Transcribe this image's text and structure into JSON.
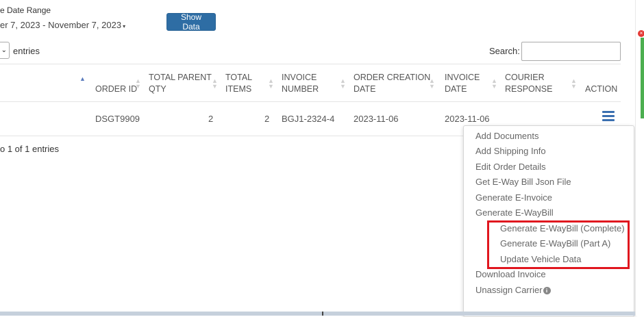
{
  "filters": {
    "date_range_label": "e Date Range",
    "date_range_value": "er 7, 2023 - November 7, 2023",
    "date_caret": "▾",
    "show_button": "Show Data"
  },
  "table_controls": {
    "length_caret": "⌄",
    "entries_label": "entries",
    "search_label": "Search:",
    "search_value": ""
  },
  "table": {
    "columns": [
      {
        "line1": "ORDER ID",
        "line2": ""
      },
      {
        "line1": "TOTAL PARENT",
        "line2": "QTY"
      },
      {
        "line1": "TOTAL",
        "line2": "ITEMS"
      },
      {
        "line1": "INVOICE",
        "line2": "NUMBER"
      },
      {
        "line1": "ORDER CREATION",
        "line2": "DATE"
      },
      {
        "line1": "INVOICE",
        "line2": "DATE"
      },
      {
        "line1": "COURIER",
        "line2": "RESPONSE"
      },
      {
        "line1": "ACTION",
        "line2": ""
      }
    ],
    "sort_asc": "▲",
    "sort_both": "▲▼",
    "rows": [
      {
        "order_id": "DSGT9909",
        "total_parent_qty": "2",
        "total_items": "2",
        "invoice_number": "BGJ1-2324-4",
        "order_creation_date": "2023-11-06",
        "invoice_date": "2023-11-06",
        "courier_response": ""
      }
    ],
    "info": "o 1 of 1 entries"
  },
  "action_menu": {
    "items": [
      "Add Documents",
      "Add Shipping Info",
      "Edit Order Details",
      "Get E-Way Bill Json File",
      "Generate E-Invoice",
      "Generate E-WayBill"
    ],
    "sub_items": [
      "Generate E-WayBill (Complete)",
      "Generate E-WayBill (Part A)",
      "Update Vehicle Data"
    ],
    "items_after": [
      "Download Invoice",
      "Unassign Carrier"
    ],
    "info_icon": "i"
  },
  "colors": {
    "primary_button": "#2e6da4",
    "highlight_border": "#e0161e",
    "action_icon": "#3a6fb0"
  }
}
